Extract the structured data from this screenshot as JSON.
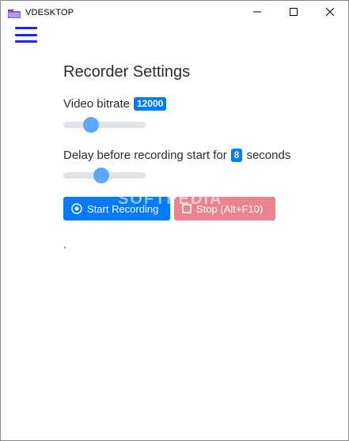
{
  "window": {
    "title": "VDESKTOP",
    "controls": [
      "minimize-icon",
      "maximize-icon",
      "close-icon"
    ]
  },
  "menu": {
    "icon": "hamburger-menu-icon"
  },
  "settings": {
    "heading": "Recorder Settings",
    "bitrate_label": "Video bitrate",
    "bitrate_value": "12000",
    "bitrate_slider_fraction": 0.3,
    "delay_label_prefix": "Delay before recording start for",
    "delay_value": "8",
    "delay_label_suffix": "seconds",
    "delay_slider_fraction": 0.45
  },
  "buttons": {
    "start_label": "Start Recording",
    "stop_label": "Stop (Alt+F10)"
  },
  "status_text": ".",
  "watermark": "SOFTPEDIA",
  "colors": {
    "primary": "#007bff",
    "danger_disabled": "#e9848f",
    "menu": "#1f1fff",
    "thumb": "#5aa9ff"
  }
}
